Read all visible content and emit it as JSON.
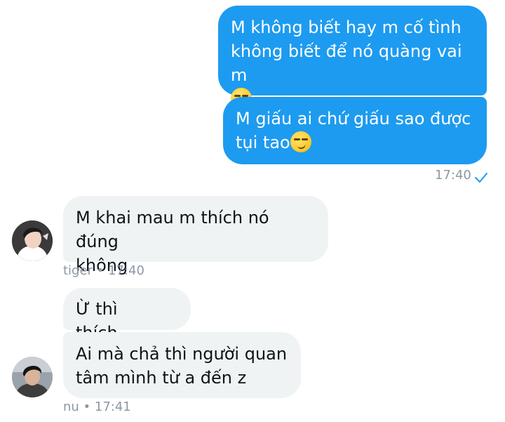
{
  "messages": {
    "sent_1": {
      "line1": "M không biết hay m cố tình",
      "line2": "không biết để nó quàng vai m",
      "emoji": "smirking-face-emoji"
    },
    "sent_2": {
      "line1": "M giấu ai chứ giấu sao được",
      "line2": "tụi tao",
      "emoji": "smirking-face-emoji"
    },
    "sent_time": "17:40",
    "recv_1": {
      "line1": "M khai mau m thích nó đúng",
      "line2": "không"
    },
    "recv_1_meta": "tiger • 17:40",
    "recv_2": {
      "line1": "Ừ thì thích..."
    },
    "recv_3": {
      "line1": "Ai mà chả thì người quan",
      "line2": "tâm mình từ a đến z"
    },
    "recv_3_meta": "nu • 17:41"
  },
  "colors": {
    "sent_bubble": "#1d9bf0",
    "received_bubble": "#eff3f4",
    "meta_text": "#8b98a5"
  }
}
